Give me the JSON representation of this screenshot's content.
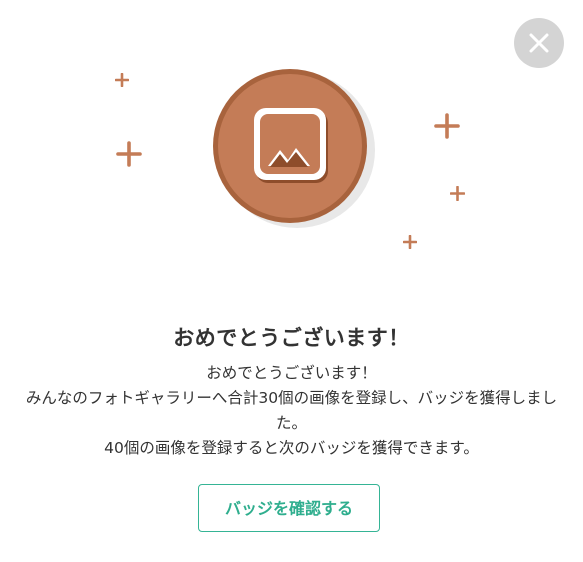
{
  "modal": {
    "close_icon": "close-icon",
    "badge_icon": "image-gallery-icon",
    "sparkle_icon": "plus-sparkle-icon",
    "title": "おめでとうございます！",
    "message_lines": [
      "おめでとうございます！",
      "みんなのフォトギャラリーへ合計30個の画像を登録し、バッジを獲得しました。",
      "40個の画像を登録すると次のバッジを獲得できます。"
    ],
    "confirm_button_label": "バッジを確認する"
  },
  "colors": {
    "badge_bronze": "#c47c57",
    "badge_dark": "#9e5a35",
    "sparkle": "#c47c57",
    "accent_green": "#35b495",
    "close_bg": "#d4d4d4"
  }
}
